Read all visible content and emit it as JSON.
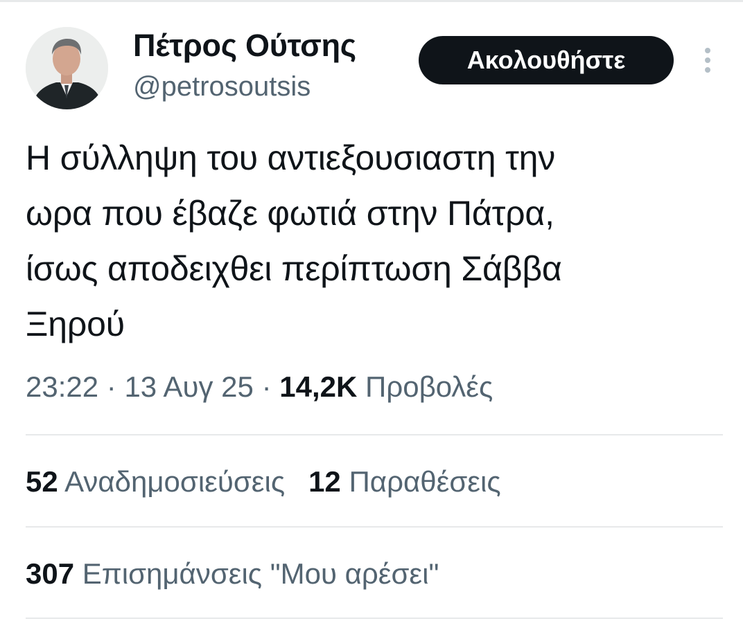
{
  "author": {
    "display_name": "Πέτρος Ούτσης",
    "handle": "@petrosoutsis",
    "avatar_icon": "profile-photo"
  },
  "header": {
    "follow_label": "Ακολουθήστε",
    "more_icon": "more-vertical-icon"
  },
  "tweet": {
    "lines": [
      "Η σύλληψη του αντιεξουσιαστη την",
      "ωρα που έβαζε φωτιά στην Πάτρα,",
      "ίσως αποδειχθει περίπτωση Σάββα",
      "Ξηρού"
    ]
  },
  "meta": {
    "time": "23:22",
    "separator": "·",
    "date": "13 Αυγ 25",
    "views_count": "14,2K",
    "views_label": "Προβολές"
  },
  "stats": {
    "reposts_count": "52",
    "reposts_label": "Αναδημοσιεύσεις",
    "quotes_count": "12",
    "quotes_label": "Παραθέσεις",
    "likes_count": "307",
    "likes_label": "Επισημάνσεις \"Μου αρέσει\""
  },
  "colors": {
    "text_primary": "#0f1419",
    "text_secondary": "#536471",
    "divider": "#e7e9ea",
    "button_bg": "#0f1419",
    "button_text": "#ffffff"
  }
}
